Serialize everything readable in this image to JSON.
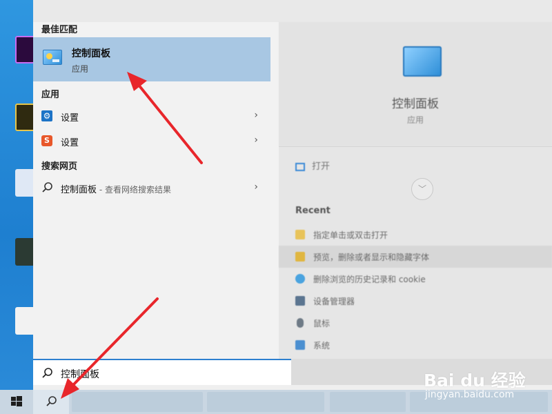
{
  "start_menu": {
    "best_match_header": "最佳匹配",
    "best_match": {
      "title": "控制面板",
      "subtitle": "应用",
      "icon": "control-panel-icon"
    },
    "apps_header": "应用",
    "apps": [
      {
        "label": "设置",
        "icon": "settings-gear-icon"
      },
      {
        "label": "设置",
        "icon": "sogou-s-icon"
      }
    ],
    "web_header": "搜索网页",
    "web_result": {
      "label": "控制面板",
      "suffix": " - 查看网络搜索结果",
      "icon": "search-icon"
    }
  },
  "preview": {
    "title": "控制面板",
    "subtitle": "应用",
    "open_label": "打开",
    "recent_header": "Recent",
    "recent_items": [
      {
        "label": "指定单击或双击打开"
      },
      {
        "label": "预览，删除或者显示和隐藏字体"
      },
      {
        "label": "删除浏览的历史记录和 cookie"
      },
      {
        "label": "设备管理器"
      },
      {
        "label": "鼠标"
      },
      {
        "label": "系统"
      }
    ]
  },
  "search": {
    "value": "控制面板"
  },
  "watermark": {
    "main": "Bai du 经验",
    "sub": "jingyan.baidu.com"
  },
  "colors": {
    "accent": "#2c7fcf",
    "selection": "#a8c7e3",
    "arrow": "#e8262b"
  }
}
